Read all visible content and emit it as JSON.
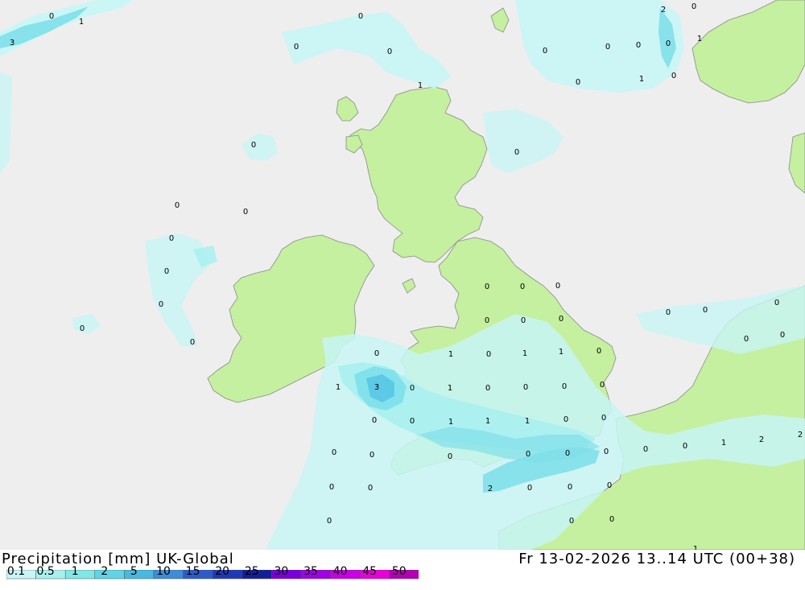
{
  "header": {
    "title": "Precipitation [mm] UK-Global",
    "datetime": "Fr 13-02-2026 13..14 UTC (00+38)"
  },
  "legend": {
    "labels": [
      "0.1",
      "0.5",
      "1",
      "2",
      "5",
      "10",
      "15",
      "20",
      "25",
      "30",
      "35",
      "40",
      "45",
      "50"
    ],
    "colors": [
      "#c8f5f5",
      "#a8f0f0",
      "#80e6e6",
      "#60d4e6",
      "#48b8e0",
      "#3c8cd8",
      "#2c5ccc",
      "#2038b8",
      "#141e96",
      "#7800dc",
      "#a000e6",
      "#c800e6",
      "#e600dc",
      "#b400b4"
    ]
  },
  "colors": {
    "sea": "#eeeeee",
    "land": "#c4f0a0",
    "precip_light": "#c8f5f5",
    "precip_mid": "#a8f0f0",
    "precip_heavy": "#80e0ea",
    "precip_max": "#58c8e6"
  },
  "map_values": [
    {
      "t": "0"
    },
    {
      "t": "1"
    },
    {
      "t": "3"
    },
    {
      "t": "0"
    },
    {
      "t": "0"
    },
    {
      "t": "0"
    },
    {
      "t": "1"
    },
    {
      "t": "0"
    },
    {
      "t": "0"
    },
    {
      "t": "0"
    },
    {
      "t": "0"
    },
    {
      "t": "1"
    },
    {
      "t": "0"
    },
    {
      "t": "2"
    },
    {
      "t": "0"
    },
    {
      "t": "1"
    },
    {
      "t": "0"
    },
    {
      "t": "0"
    },
    {
      "t": "0"
    },
    {
      "t": "0"
    },
    {
      "t": "0"
    },
    {
      "t": "0"
    },
    {
      "t": "0"
    },
    {
      "t": "0"
    },
    {
      "t": "0"
    },
    {
      "t": "0"
    },
    {
      "t": "0"
    },
    {
      "t": "0"
    },
    {
      "t": "0"
    },
    {
      "t": "0"
    },
    {
      "t": "0"
    },
    {
      "t": "0"
    },
    {
      "t": "0"
    },
    {
      "t": "0"
    },
    {
      "t": "0"
    },
    {
      "t": "0"
    },
    {
      "t": "0"
    },
    {
      "t": "0"
    },
    {
      "t": "1"
    },
    {
      "t": "0"
    },
    {
      "t": "1"
    },
    {
      "t": "1"
    },
    {
      "t": "0"
    },
    {
      "t": "1"
    },
    {
      "t": "3"
    },
    {
      "t": "0"
    },
    {
      "t": "1"
    },
    {
      "t": "0"
    },
    {
      "t": "0"
    },
    {
      "t": "0"
    },
    {
      "t": "0"
    },
    {
      "t": "0"
    },
    {
      "t": "0"
    },
    {
      "t": "1"
    },
    {
      "t": "1"
    },
    {
      "t": "1"
    },
    {
      "t": "0"
    },
    {
      "t": "0"
    },
    {
      "t": "0"
    },
    {
      "t": "0"
    },
    {
      "t": "0"
    },
    {
      "t": "0"
    },
    {
      "t": "0"
    },
    {
      "t": "1"
    },
    {
      "t": "2"
    },
    {
      "t": "2"
    },
    {
      "t": "0"
    },
    {
      "t": "0"
    },
    {
      "t": "0"
    },
    {
      "t": "2"
    },
    {
      "t": "0"
    },
    {
      "t": "0"
    },
    {
      "t": "0"
    },
    {
      "t": "0"
    },
    {
      "t": "0"
    },
    {
      "t": "0"
    },
    {
      "t": "0"
    },
    {
      "t": "0"
    },
    {
      "t": "1"
    }
  ]
}
